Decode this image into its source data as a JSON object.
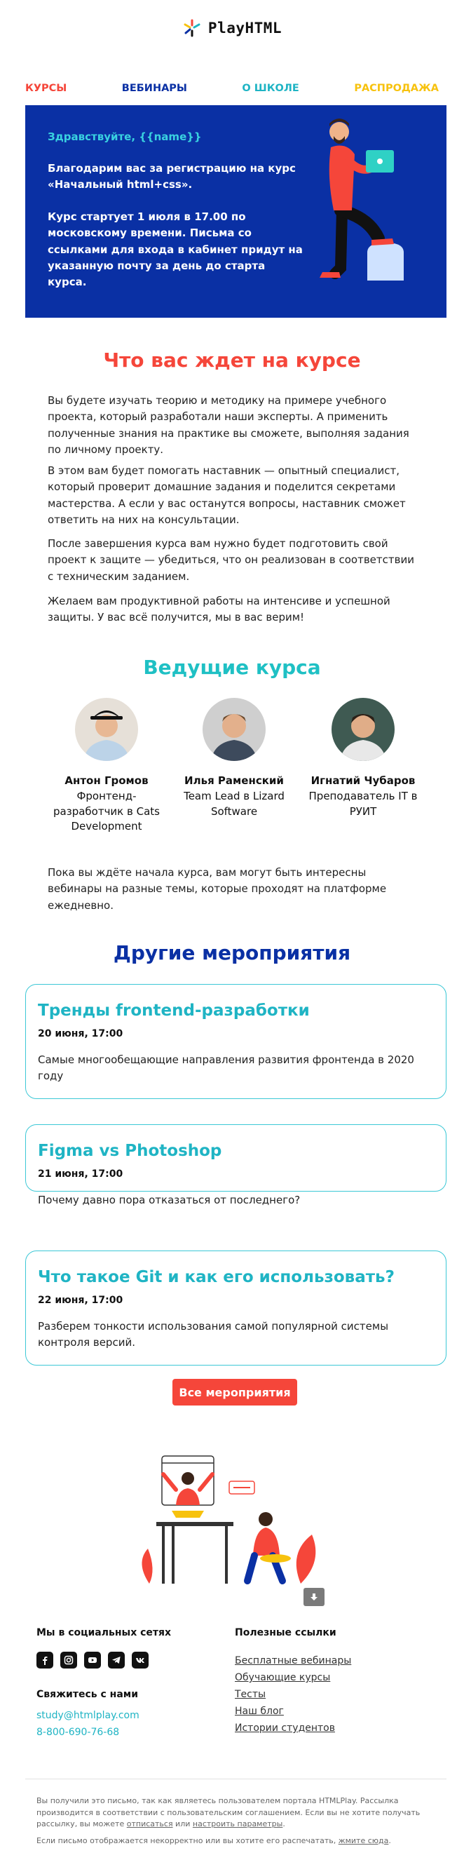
{
  "header": {
    "logo_text": "PlayHTML"
  },
  "nav": [
    {
      "label": "КУРСЫ",
      "color": "#f5463a"
    },
    {
      "label": "ВЕБИНАРЫ",
      "color": "#0a30a4"
    },
    {
      "label": "О ШКОЛЕ",
      "color": "#1fb4c4"
    },
    {
      "label": "РАСПРОДАЖА",
      "color": "#f7c20e"
    }
  ],
  "hero": {
    "greeting": "Здравствуйте, {{name}}",
    "p1": "Благодарим вас за регистрацию на курс «Начальный html+css».",
    "p2": "Курс стартует 1 июля в 17.00 по московскому времени. Письма со ссылками для входа в кабинет придут на указанную почту за день до старта курса."
  },
  "course": {
    "title": "Что вас ждет на курсе",
    "paragraphs": [
      "Вы будете изучать теорию и методику на примере учебного проекта, который разработали наши эксперты. А применить полученные знания на практике вы сможете, выполняя задания по личному проекту.",
      "В этом вам будет помогать наставник — опытный специалист, который проверит домашние задания и поделится секретами мастерства. А если у вас останутся вопросы, наставник сможет ответить на них на консультации.",
      "После завершения курса вам нужно будет подготовить свой проект к защите — убедиться, что он реализован в соответствии с техническим заданием.",
      "Желаем вам продуктивной работы на интенсиве и успешной защиты. У вас всё получится, мы в вас верим!"
    ]
  },
  "teachers": {
    "title": "Ведущие курса",
    "items": [
      {
        "name": "Антон Громов",
        "role": "Фронтенд-разработчик в Cats Development"
      },
      {
        "name": "Илья Раменский",
        "role": "Team Lead в Lizard Software"
      },
      {
        "name": "Игнатий Чубаров",
        "role": "Преподаватель IT в РУИТ"
      }
    ]
  },
  "webinars_note": "Пока вы ждёте начала курса, вам могут быть интересны вебинары на разные темы, которые проходят на платформе ежедневно.",
  "events": {
    "title": "Другие мероприятия",
    "items": [
      {
        "title": "Тренды frontend-разработки",
        "date": "20 июня, 17:00",
        "description": "Самые многообещающие направления развития фронтенда в 2020 году"
      },
      {
        "title": "Figma vs Photoshop",
        "date": "21 июня, 17:00",
        "description": "Почему давно пора отказаться от последнего?"
      },
      {
        "title": "Что такое Git и как его использовать?",
        "date": "22 июня, 17:00",
        "description": "Разберем тонкости использования самой популярной системы контроля версий."
      }
    ],
    "all_button": "Все мероприятия"
  },
  "footer": {
    "social_title": "Мы в социальных сетях",
    "social_icons": [
      "facebook-icon",
      "instagram-icon",
      "youtube-icon",
      "telegram-icon",
      "vk-icon"
    ],
    "contact_title": "Свяжитесь с нами",
    "email": "study@htmlplay.com",
    "phone": "8-800-690-76-68",
    "links_title": "Полезные ссылки",
    "links": [
      "Бесплатные вебинары",
      "Обучающие курсы",
      "Тесты",
      "Наш блог",
      "Истории студентов"
    ],
    "legal1_a": "Вы получили это письмо, так как являетесь пользователем портала HTMLPlay. Рассылка производится в соответствии с пользовательским соглашением. Если вы не хотите получать рассылку, вы можете ",
    "legal1_link1": "отписаться",
    "legal1_b": " или ",
    "legal1_link2": "настроить параметры",
    "legal1_c": ".",
    "legal2_a": "Если письмо отображается некорректно или вы хотите его распечатать, ",
    "legal2_link": "жмите сюда",
    "legal2_b": "."
  }
}
